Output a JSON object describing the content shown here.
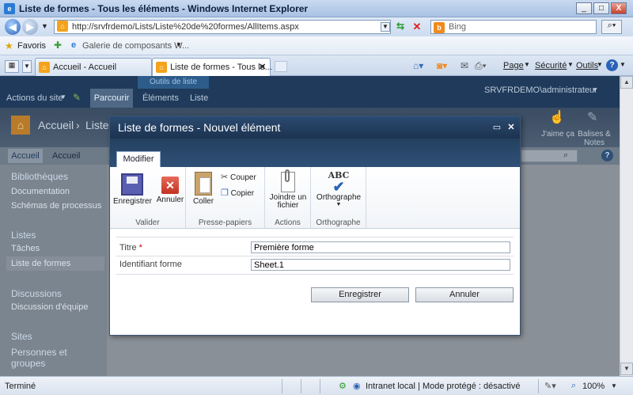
{
  "window": {
    "title": "Liste de formes - Tous les éléments - Windows Internet Explorer",
    "min": "_",
    "max": "□",
    "close": "X"
  },
  "address": {
    "url": "http://srvfrdemo/Lists/Liste%20de%20formes/AllItems.aspx",
    "search_placeholder": "Bing"
  },
  "favorites": {
    "label": "Favoris",
    "gallery": "Galerie de composants W..."
  },
  "tabs": [
    {
      "label": "Accueil - Accueil"
    },
    {
      "label": "Liste de formes - Tous le..."
    }
  ],
  "toolbar": {
    "page": "Page",
    "securite": "Sécurité",
    "outils": "Outils"
  },
  "sp": {
    "ribbon_context": "Outils de liste",
    "site_actions": "Actions du site",
    "parcourir": "Parcourir",
    "elements": "Éléments",
    "liste": "Liste",
    "user": "SRVFRDEMO\\administrateur",
    "breadcrumb": "Accueil",
    "breadcrumb_sep": "›",
    "breadcrumb_cur": "Liste",
    "nav_tab1": "Accueil",
    "nav_tab2": "Accueil",
    "like": "J'aime ça",
    "tags": "Balises & Notes"
  },
  "leftnav": {
    "bibliotheques": "Bibliothèques",
    "documentation": "Documentation",
    "schemas": "Schémas de processus",
    "listes": "Listes",
    "taches": "Tâches",
    "liste_formes": "Liste de formes",
    "discussions": "Discussions",
    "discussion_equipe": "Discussion d'équipe",
    "sites": "Sites",
    "personnes": "Personnes et groupes"
  },
  "dialog": {
    "title": "Liste de formes - Nouvel élément",
    "tab": "Modifier",
    "groups": {
      "valider": "Valider",
      "presse": "Presse-papiers",
      "actions": "Actions",
      "ortho": "Orthographe"
    },
    "buttons": {
      "enregistrer": "Enregistrer",
      "annuler": "Annuler",
      "coller": "Coller",
      "couper": "Couper",
      "copier": "Copier",
      "joindre1": "Joindre un",
      "joindre2": "fichier",
      "orthographe": "Orthographe",
      "abc": "ABC"
    },
    "fields": {
      "titre_label": "Titre",
      "required": "*",
      "titre_value": "Première forme",
      "ident_label": "Identifiant forme",
      "ident_value": "Sheet.1"
    },
    "save": "Enregistrer",
    "cancel": "Annuler"
  },
  "status": {
    "left": "Terminé",
    "zone": "Intranet local | Mode protégé : désactivé",
    "zoom": "100%"
  }
}
